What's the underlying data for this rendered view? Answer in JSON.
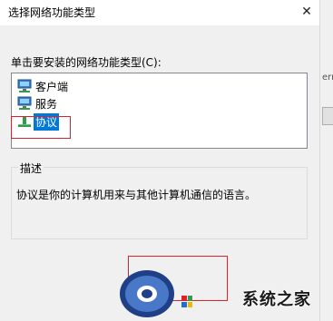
{
  "dialog": {
    "title": "选择网络功能类型",
    "close_glyph": "✕",
    "prompt": "单击要安装的网络功能类型(C):",
    "items": [
      {
        "label": "客户端",
        "icon": "network-client-icon",
        "selected": false
      },
      {
        "label": "服务",
        "icon": "network-service-icon",
        "selected": false
      },
      {
        "label": "协议",
        "icon": "network-protocol-icon",
        "selected": true
      }
    ],
    "description": {
      "caption": "描述",
      "text": "协议是你的计算机用来与其他计算机通信的语言。"
    }
  },
  "background_window": {
    "fragment_text": "erne"
  },
  "watermark": {
    "text": "系统之家"
  },
  "colors": {
    "selection": "#0078d7",
    "highlight_box": "#e0202a",
    "dialog_bg": "#f0f0f0"
  }
}
